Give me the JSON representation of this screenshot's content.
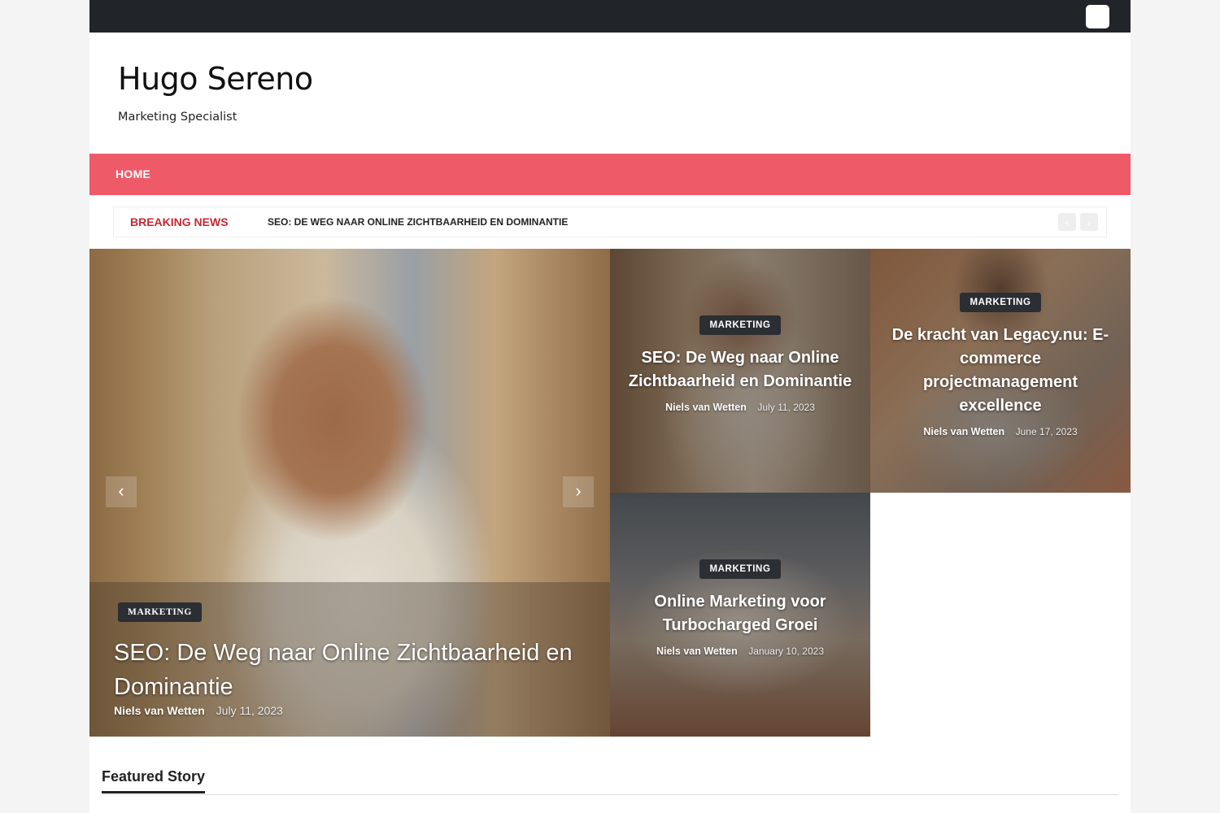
{
  "topbar": {
    "toggle_icon": "theme-toggle-icon"
  },
  "site": {
    "title": "Hugo Sereno",
    "tagline": "Marketing Specialist"
  },
  "nav": {
    "items": [
      {
        "label": "HOME"
      }
    ]
  },
  "breaking": {
    "label": "BREAKING NEWS",
    "headline": "SEO: DE WEG NAAR ONLINE ZICHTBAARHEID EN DOMINANTIE",
    "prev_icon": "chevron-left-icon",
    "next_icon": "chevron-right-icon"
  },
  "hero": {
    "category": "MARKETING",
    "title": "SEO: De Weg naar Online Zichtbaarheid en Dominantie",
    "author": "Niels van Wetten",
    "date": "July 11, 2023",
    "prev_icon": "chevron-left-icon",
    "next_icon": "chevron-right-icon"
  },
  "cards": [
    {
      "category": "MARKETING",
      "title": "SEO: De Weg naar Online Zichtbaarheid en Dominantie",
      "author": "Niels van Wetten",
      "date": "July 11, 2023"
    },
    {
      "category": "MARKETING",
      "title": "De kracht van Legacy.nu: E-commerce projectmanagement excellence",
      "author": "Niels van Wetten",
      "date": "June 17, 2023"
    },
    {
      "category": "MARKETING",
      "title": "Online Marketing voor Turbocharged Groei",
      "author": "Niels van Wetten",
      "date": "January 10, 2023"
    }
  ],
  "featured": {
    "title": "Featured Story"
  },
  "colors": {
    "nav": "#ef5a69",
    "topbar": "#212529",
    "breaking_label": "#c62833",
    "badge": "#2b2e33"
  }
}
